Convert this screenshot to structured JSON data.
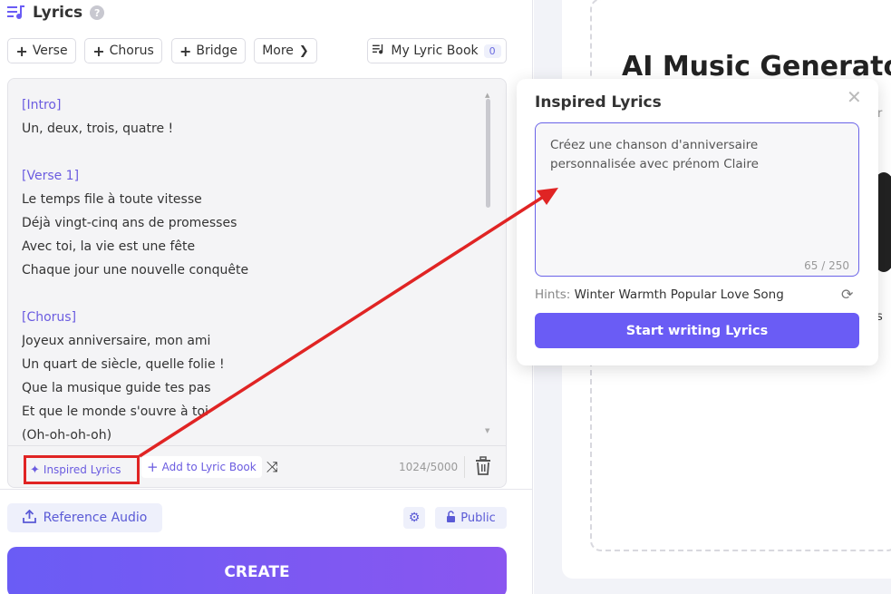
{
  "lyrics": {
    "title": "Lyrics",
    "help": "?",
    "chips": {
      "verse": "Verse",
      "chorus": "Chorus",
      "bridge": "Bridge",
      "more": "More",
      "lyric_book": "My Lyric Book",
      "lyric_book_count": "0"
    },
    "lines": [
      {
        "text": "[Intro]",
        "tag": true
      },
      {
        "text": "Un, deux, trois, quatre !",
        "tag": false
      },
      {
        "text": "",
        "tag": false
      },
      {
        "text": "[Verse 1]",
        "tag": true
      },
      {
        "text": "Le temps file à toute vitesse",
        "tag": false
      },
      {
        "text": "Déjà vingt-cinq ans de promesses",
        "tag": false
      },
      {
        "text": "Avec toi, la vie est une fête",
        "tag": false
      },
      {
        "text": "Chaque jour une nouvelle conquête",
        "tag": false
      },
      {
        "text": "",
        "tag": false
      },
      {
        "text": "[Chorus]",
        "tag": true
      },
      {
        "text": "Joyeux anniversaire, mon ami",
        "tag": false
      },
      {
        "text": "Un quart de siècle, quelle folie !",
        "tag": false
      },
      {
        "text": "Que la musique guide tes pas",
        "tag": false
      },
      {
        "text": "Et que le monde s'ouvre à toi",
        "tag": false
      },
      {
        "text": "(Oh-oh-oh-oh)",
        "tag": false
      }
    ],
    "toolbar": {
      "inspired": "Inspired Lyrics",
      "add_book": "Add to Lyric Book",
      "counter": "1024/5000"
    }
  },
  "bottom": {
    "reference_audio": "Reference Audio",
    "public": "Public",
    "create": "CREATE"
  },
  "right": {
    "title": "AI Music Generato",
    "peek_or": "or",
    "peek_s": "s"
  },
  "popup": {
    "title": "Inspired Lyrics",
    "close": "✕",
    "prompt": "Créez une chanson d'anniversaire personnalisée avec prénom Claire",
    "count": "65 / 250",
    "hints_label": "Hints:",
    "hints_value": "Winter Warmth Popular Love Song",
    "start": "Start writing Lyrics"
  },
  "colors": {
    "accent": "#6a5cf5",
    "tag": "#6b5ce0",
    "highlight": "#e02424"
  }
}
